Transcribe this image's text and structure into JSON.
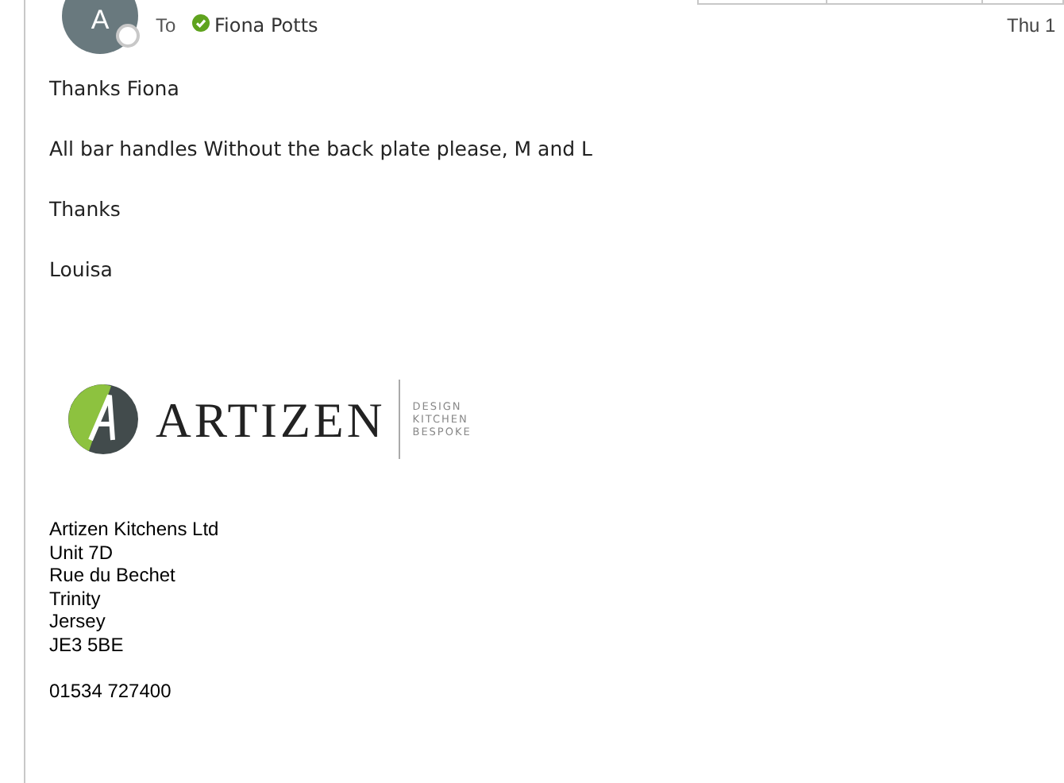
{
  "header": {
    "avatar_initial": "A",
    "to_label": "To",
    "recipient": {
      "name": "Fiona Potts",
      "verified": true
    },
    "date": "Thu 1"
  },
  "body": [
    "Thanks Fiona",
    "All bar handles Without the back plate please, M and L",
    "Thanks",
    "Louisa"
  ],
  "signature": {
    "logo": {
      "name": "ARTIZEN",
      "tagline": [
        "DESIGN",
        "KITCHEN",
        "BESPOKE"
      ]
    },
    "address": [
      "Artizen Kitchens Ltd",
      "Unit 7D",
      "Rue du Bechet",
      "Trinity",
      "Jersey",
      "JE3 5BE"
    ],
    "phone": "01534 727400"
  }
}
